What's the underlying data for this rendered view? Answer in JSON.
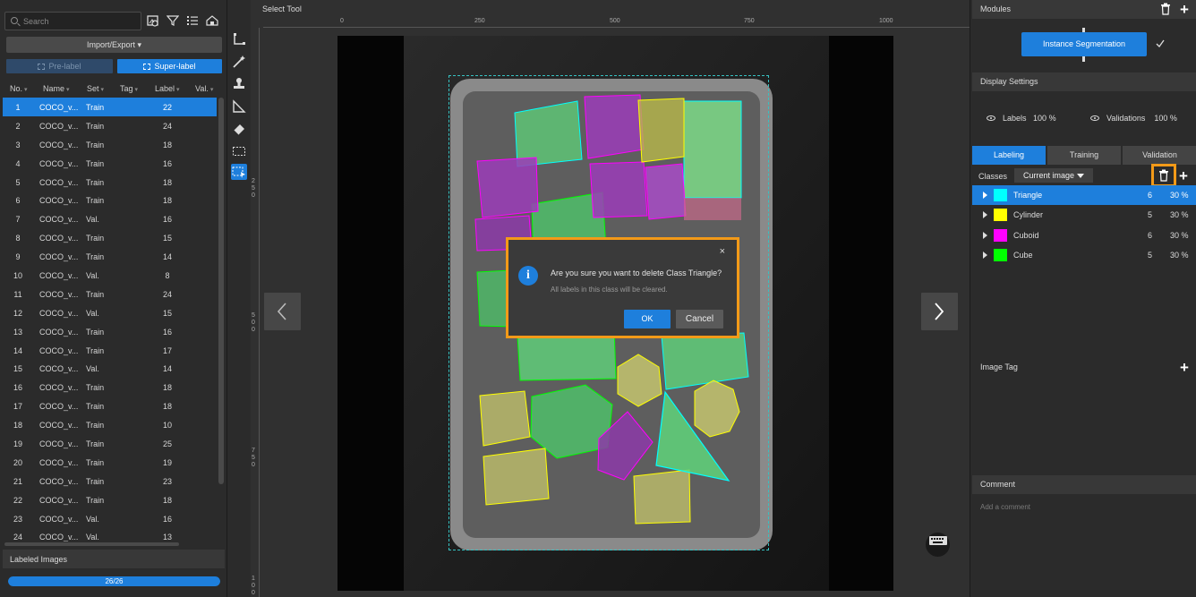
{
  "left": {
    "search_placeholder": "Search",
    "import_export": "Import/Export",
    "pre_label": "Pre-label",
    "super_label": "Super-label",
    "columns": [
      "No.",
      "Name",
      "Set",
      "Tag",
      "Label",
      "Val."
    ],
    "rows": [
      {
        "no": "1",
        "name": "COCO_v...",
        "set": "Train",
        "label": "22"
      },
      {
        "no": "2",
        "name": "COCO_v...",
        "set": "Train",
        "label": "24"
      },
      {
        "no": "3",
        "name": "COCO_v...",
        "set": "Train",
        "label": "18"
      },
      {
        "no": "4",
        "name": "COCO_v...",
        "set": "Train",
        "label": "16"
      },
      {
        "no": "5",
        "name": "COCO_v...",
        "set": "Train",
        "label": "18"
      },
      {
        "no": "6",
        "name": "COCO_v...",
        "set": "Train",
        "label": "18"
      },
      {
        "no": "7",
        "name": "COCO_v...",
        "set": "Val.",
        "label": "16"
      },
      {
        "no": "8",
        "name": "COCO_v...",
        "set": "Train",
        "label": "15"
      },
      {
        "no": "9",
        "name": "COCO_v...",
        "set": "Train",
        "label": "14"
      },
      {
        "no": "10",
        "name": "COCO_v...",
        "set": "Val.",
        "label": "8"
      },
      {
        "no": "11",
        "name": "COCO_v...",
        "set": "Train",
        "label": "24"
      },
      {
        "no": "12",
        "name": "COCO_v...",
        "set": "Val.",
        "label": "15"
      },
      {
        "no": "13",
        "name": "COCO_v...",
        "set": "Train",
        "label": "16"
      },
      {
        "no": "14",
        "name": "COCO_v...",
        "set": "Train",
        "label": "17"
      },
      {
        "no": "15",
        "name": "COCO_v...",
        "set": "Val.",
        "label": "14"
      },
      {
        "no": "16",
        "name": "COCO_v...",
        "set": "Train",
        "label": "18"
      },
      {
        "no": "17",
        "name": "COCO_v...",
        "set": "Train",
        "label": "18"
      },
      {
        "no": "18",
        "name": "COCO_v...",
        "set": "Train",
        "label": "10"
      },
      {
        "no": "19",
        "name": "COCO_v...",
        "set": "Train",
        "label": "25"
      },
      {
        "no": "20",
        "name": "COCO_v...",
        "set": "Train",
        "label": "19"
      },
      {
        "no": "21",
        "name": "COCO_v...",
        "set": "Train",
        "label": "23"
      },
      {
        "no": "22",
        "name": "COCO_v...",
        "set": "Train",
        "label": "18"
      },
      {
        "no": "23",
        "name": "COCO_v...",
        "set": "Val.",
        "label": "16"
      },
      {
        "no": "24",
        "name": "COCO_v...",
        "set": "Val.",
        "label": "13"
      }
    ],
    "selected_row": 0,
    "labeled_images_title": "Labeled Images",
    "labeled_progress_text": "26/26",
    "labeled_progress_fraction": 1.0
  },
  "tools": {
    "icons": [
      "polygon-tool-icon",
      "magic-wand-icon",
      "stamp-icon",
      "ruler-tool-icon",
      "eraser-icon",
      "select-rect-icon",
      "select-tool-icon"
    ],
    "active_index": 6
  },
  "center": {
    "title": "Select Tool",
    "ruler_top_ticks": [
      "0",
      "250",
      "500",
      "750",
      "1000"
    ],
    "ruler_left_ticks": [
      "250",
      "500",
      "750",
      "1000"
    ],
    "dialog": {
      "question": "Are you sure you want to delete Class Triangle?",
      "subtext": "All labels in this class will be cleared.",
      "ok": "OK",
      "cancel": "Cancel",
      "close": "×"
    },
    "accent_color": "#1e7fdc",
    "highlight_color": "#f39a18"
  },
  "right": {
    "modules_title": "Modules",
    "module_name": "Instance Segmentation",
    "display_settings_title": "Display Settings",
    "labels_label": "Labels",
    "labels_value": "100 %",
    "validations_label": "Validations",
    "validations_value": "100 %",
    "tabs": [
      "Labeling",
      "Training",
      "Validation"
    ],
    "active_tab": 0,
    "classes_label": "Classes",
    "classes_scope": "Current image",
    "classes": [
      {
        "name": "Triangle",
        "color": "#00ffff",
        "count": "6",
        "percent": "30 %"
      },
      {
        "name": "Cylinder",
        "color": "#ffff00",
        "count": "5",
        "percent": "30 %"
      },
      {
        "name": "Cuboid",
        "color": "#ff00ff",
        "count": "6",
        "percent": "30 %"
      },
      {
        "name": "Cube",
        "color": "#00ff00",
        "count": "5",
        "percent": "30 %"
      }
    ],
    "selected_class": 0,
    "image_tag_title": "Image Tag",
    "comment_title": "Comment",
    "comment_placeholder": "Add a comment"
  }
}
